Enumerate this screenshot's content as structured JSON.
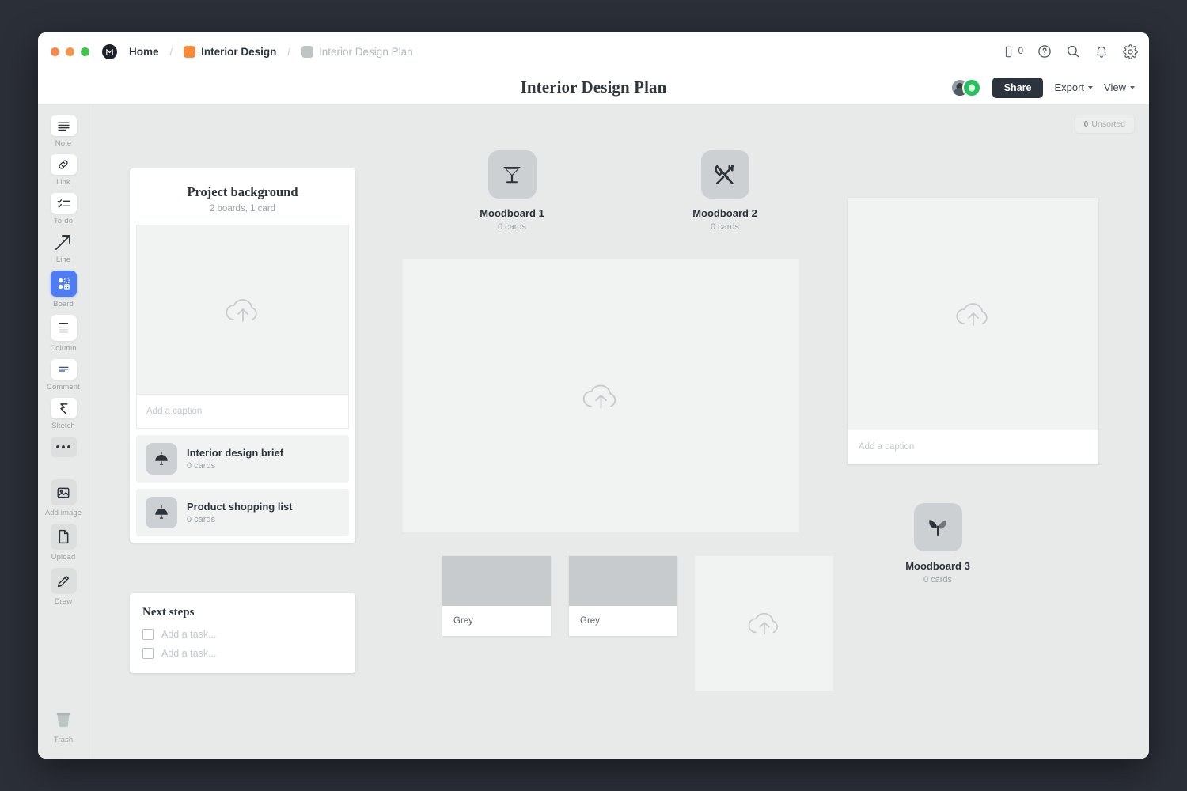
{
  "window": {
    "traffic_lights": [
      "close",
      "minimize",
      "maximize"
    ],
    "breadcrumb": {
      "home": "Home",
      "sep": "/",
      "project": "Interior Design",
      "current": "Interior Design Plan"
    },
    "top_right": {
      "device_count": "0",
      "icons": [
        "phone-icon",
        "help-icon",
        "search-icon",
        "bell-icon",
        "gear-icon"
      ]
    }
  },
  "header": {
    "title": "Interior Design Plan",
    "share_label": "Share",
    "export_label": "Export",
    "view_label": "View"
  },
  "sidebar": {
    "items": [
      {
        "label": "Note",
        "icon": "note-icon"
      },
      {
        "label": "Link",
        "icon": "link-icon"
      },
      {
        "label": "To-do",
        "icon": "todo-icon"
      },
      {
        "label": "Line",
        "icon": "line-icon"
      },
      {
        "label": "Board",
        "icon": "board-icon"
      },
      {
        "label": "Column",
        "icon": "column-icon"
      },
      {
        "label": "Comment",
        "icon": "comment-icon"
      },
      {
        "label": "Sketch",
        "icon": "sketch-icon"
      },
      {
        "label": "",
        "icon": "more-icon"
      },
      {
        "label": "Add image",
        "icon": "image-icon"
      },
      {
        "label": "Upload",
        "icon": "file-icon"
      },
      {
        "label": "Draw",
        "icon": "pencil-icon"
      },
      {
        "label": "Trash",
        "icon": "trash-icon"
      }
    ],
    "active": "Board"
  },
  "canvas": {
    "unsorted": {
      "count": "0",
      "label": "Unsorted"
    },
    "project_card": {
      "title": "Project background",
      "subtitle": "2 boards, 1 card",
      "caption_placeholder": "Add a caption",
      "boards": [
        {
          "name": "Interior design brief",
          "cards": "0 cards",
          "icon": "lamp-icon"
        },
        {
          "name": "Product shopping list",
          "cards": "0 cards",
          "icon": "lamp-icon"
        }
      ]
    },
    "next_steps": {
      "title": "Next steps",
      "tasks": [
        {
          "placeholder": "Add a task...",
          "checked": false
        },
        {
          "placeholder": "Add a task...",
          "checked": false
        }
      ]
    },
    "moodboards": [
      {
        "name": "Moodboard 1",
        "cards": "0 cards",
        "icon": "cocktail-icon"
      },
      {
        "name": "Moodboard 2",
        "cards": "0 cards",
        "icon": "cutlery-icon"
      },
      {
        "name": "Moodboard 3",
        "cards": "0 cards",
        "icon": "sprout-icon"
      }
    ],
    "right_card": {
      "caption_placeholder": "Add a caption"
    },
    "swatches": [
      {
        "label": "Grey",
        "color": "#c7cbcd"
      },
      {
        "label": "Grey",
        "color": "#c7cbcd"
      }
    ]
  },
  "colors": {
    "accent_orange": "#f58a3c",
    "accent_blue": "#4d7cf5",
    "share_dark": "#2b343d",
    "canvas_bg": "#e8eae9",
    "placeholder_bg": "#f1f3f2"
  }
}
